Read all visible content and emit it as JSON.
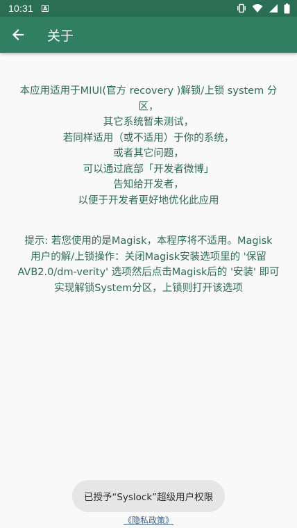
{
  "status_bar": {
    "time": "10:31",
    "icons": [
      "notification-a-icon",
      "vibrate-icon",
      "wifi-icon",
      "signal-icon",
      "battery-icon"
    ]
  },
  "app_bar": {
    "title": "关于",
    "back_icon": "arrow-left-icon",
    "background": "#317f63"
  },
  "about": {
    "lines": [
      "本应用适用于MIUI(官方 recovery )解锁/上锁 system 分",
      "区，",
      "其它系统暂未测试，",
      "若同样适用（或不适用）于你的系统，",
      "或者其它问题，",
      "可以通过底部「开发者微博」",
      "告知给开发者，",
      "以便于开发者更好地优化此应用"
    ],
    "tip_lines": [
      "提示: 若您使用的是Magisk，本程序将不适用。Magisk",
      "用户的解/上锁操作：关闭Magisk安装选项里的 '保留",
      "AVB2.0/dm-verity' 选项然后点击Magisk后的 '安装' 即可",
      "实现解锁System分区，上锁则打开该选项"
    ],
    "text_color": "#2d6a57"
  },
  "toast": {
    "message": "已授予“Syslock”超级用户权限"
  },
  "footer": {
    "privacy_link": "《隐私政策》"
  }
}
